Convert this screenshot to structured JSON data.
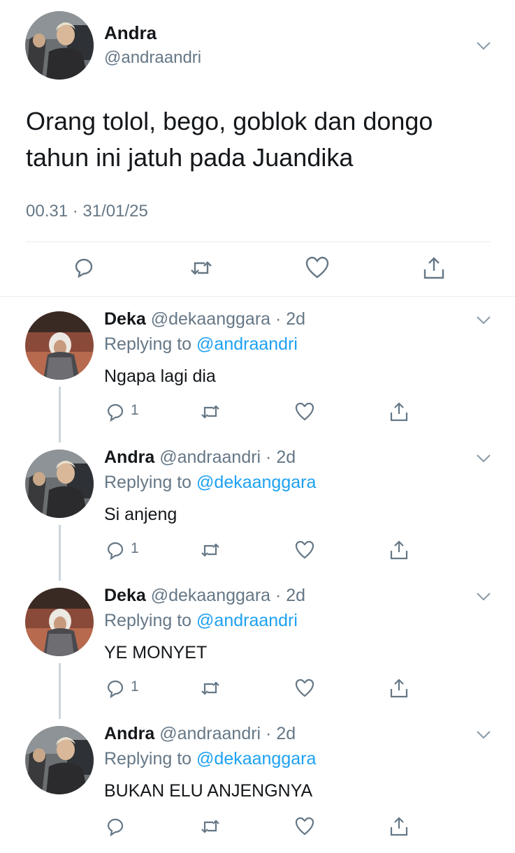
{
  "main_tweet": {
    "name": "Andra",
    "handle": "@andraandri",
    "text_line1": "Orang tolol, bego, goblok dan dongo",
    "text_line2": "tahun ini jatuh pada Juandika",
    "timestamp": "00.31 · 31/01/25",
    "actions": [
      "reply-icon",
      "retweet-icon",
      "like-icon",
      "share-icon"
    ]
  },
  "replies": [
    {
      "name": "Deka",
      "handle": "@dekaanggara · 2d",
      "replying_label": "Replying to",
      "replying_to": "@andraandri",
      "text": "Ngapa lagi dia",
      "reply_count": "1"
    },
    {
      "name": "Andra",
      "handle": "@andraandri · 2d",
      "replying_label": "Replying to",
      "replying_to": "@dekaanggara",
      "text": "Si anjeng",
      "reply_count": "1"
    },
    {
      "name": "Deka",
      "handle": "@dekaanggara · 2d",
      "replying_label": "Replying to",
      "replying_to": "@andraandri",
      "text": "YE MONYET",
      "reply_count": "1"
    },
    {
      "name": "Andra",
      "handle": "@andraandri · 2d",
      "replying_label": "Replying to",
      "replying_to": "@dekaanggara",
      "text": "BUKAN ELU ANJENGNYA",
      "reply_count": ""
    }
  ],
  "colors": {
    "accent": "#1da1f2",
    "muted": "#657786",
    "text": "#14171a",
    "divider": "#e6ecf0"
  }
}
